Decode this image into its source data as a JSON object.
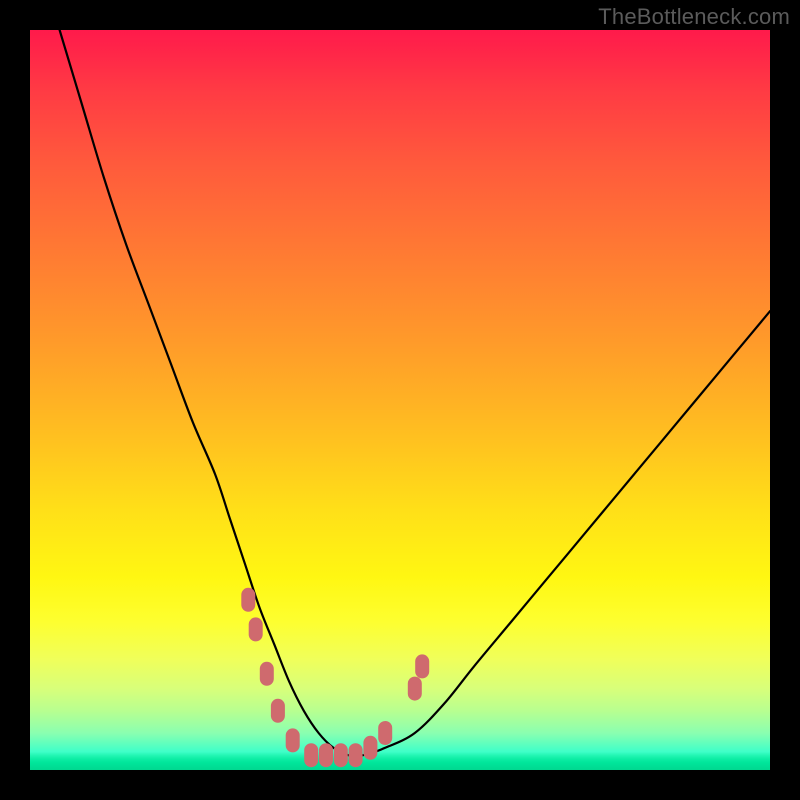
{
  "watermark": "TheBottleneck.com",
  "colors": {
    "background": "#000000",
    "gradient_top": "#ff1a4b",
    "gradient_bottom": "#00f5a0",
    "curve": "#000000",
    "markers": "#cf6a6e",
    "watermark": "#5b5b5b"
  },
  "chart_data": {
    "type": "line",
    "title": "",
    "xlabel": "",
    "ylabel": "",
    "xlim": [
      0,
      100
    ],
    "ylim": [
      0,
      100
    ],
    "grid": false,
    "legend": false,
    "series": [
      {
        "name": "curve",
        "x": [
          4,
          7,
          10,
          13,
          16,
          19,
          22,
          25,
          27,
          29,
          31,
          33,
          35,
          37,
          39,
          41,
          43,
          45,
          48,
          52,
          56,
          60,
          65,
          70,
          75,
          80,
          85,
          90,
          95,
          100
        ],
        "y": [
          100,
          90,
          80,
          71,
          63,
          55,
          47,
          40,
          34,
          28,
          22,
          17,
          12,
          8,
          5,
          3,
          2,
          2,
          3,
          5,
          9,
          14,
          20,
          26,
          32,
          38,
          44,
          50,
          56,
          62
        ]
      }
    ],
    "markers": [
      {
        "x": 29.5,
        "y": 23
      },
      {
        "x": 30.5,
        "y": 19
      },
      {
        "x": 32,
        "y": 13
      },
      {
        "x": 33.5,
        "y": 8
      },
      {
        "x": 35.5,
        "y": 4
      },
      {
        "x": 38,
        "y": 2
      },
      {
        "x": 40,
        "y": 2
      },
      {
        "x": 42,
        "y": 2
      },
      {
        "x": 44,
        "y": 2
      },
      {
        "x": 46,
        "y": 3
      },
      {
        "x": 48,
        "y": 5
      },
      {
        "x": 52,
        "y": 11
      },
      {
        "x": 53,
        "y": 14
      }
    ],
    "annotations": []
  }
}
